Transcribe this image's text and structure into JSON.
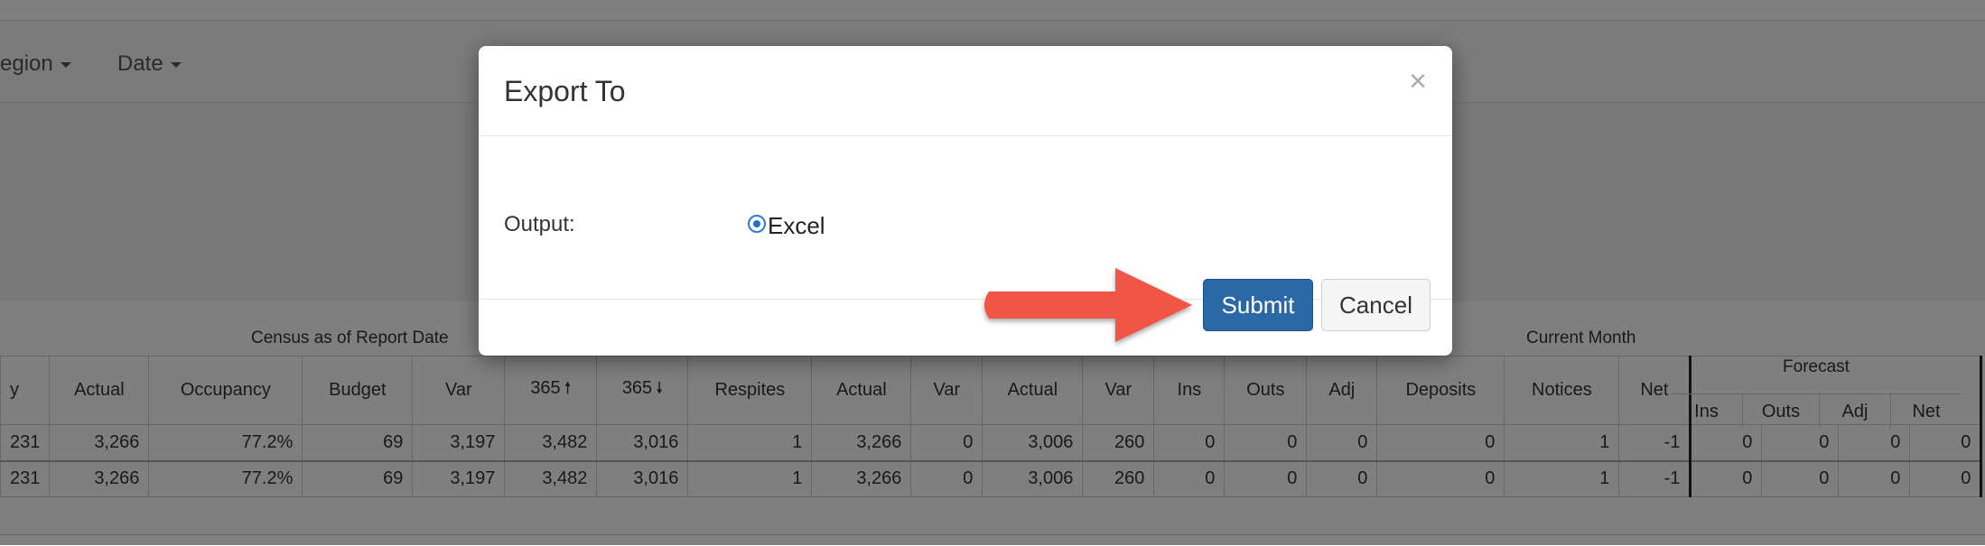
{
  "filters": {
    "region_label": "egion",
    "date_label": "Date"
  },
  "table": {
    "group_census": "Census as of Report Date",
    "group_current_month": "Current Month",
    "group_forecast": "Forecast",
    "headers": [
      "y",
      "Actual",
      "Occupancy",
      "Budget",
      "Var",
      "365",
      "365",
      "Respites",
      "Actual",
      "Var",
      "Actual",
      "Var",
      "Ins",
      "Outs",
      "Adj",
      "Deposits",
      "Notices",
      "Net"
    ],
    "forecast_headers": [
      "Ins",
      "Outs",
      "Adj",
      "Net"
    ],
    "rows": [
      [
        "231",
        "3,266",
        "77.2%",
        "69",
        "3,197",
        "3,482",
        "3,016",
        "1",
        "3,266",
        "0",
        "3,006",
        "260",
        "0",
        "0",
        "0",
        "0",
        "1",
        "-1",
        "0",
        "0",
        "0",
        "0"
      ],
      [
        "231",
        "3,266",
        "77.2%",
        "69",
        "3,197",
        "3,482",
        "3,016",
        "1",
        "3,266",
        "0",
        "3,006",
        "260",
        "0",
        "0",
        "0",
        "0",
        "1",
        "-1",
        "0",
        "0",
        "0",
        "0"
      ]
    ]
  },
  "modal": {
    "title": "Export To",
    "close_symbol": "×",
    "output_label": "Output:",
    "option_excel": "Excel",
    "submit_label": "Submit",
    "cancel_label": "Cancel"
  },
  "colors": {
    "submit_bg": "#2b68a8",
    "annotation_arrow": "#f05545",
    "radio_selected": "#1d6fd6"
  }
}
